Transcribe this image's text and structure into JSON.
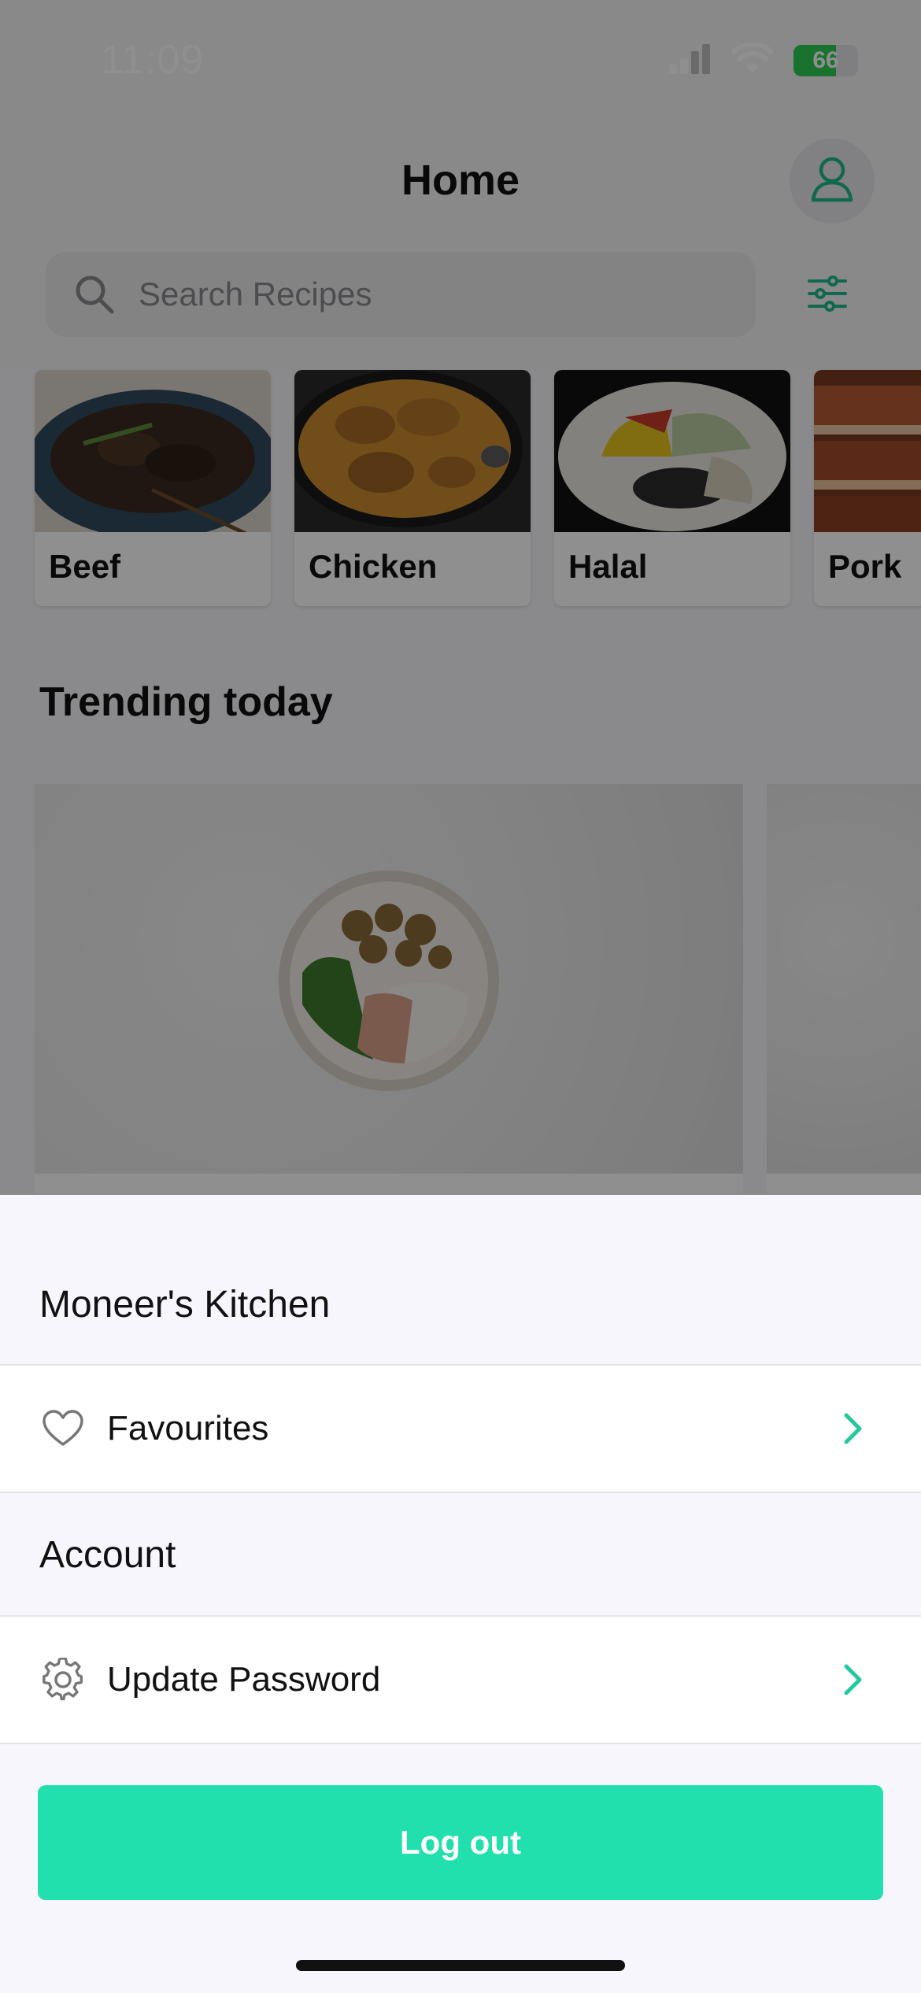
{
  "status_bar": {
    "time": "11:09",
    "battery": "66"
  },
  "header": {
    "title": "Home"
  },
  "search": {
    "placeholder": "Search Recipes"
  },
  "categories": [
    {
      "label": "Beef"
    },
    {
      "label": "Chicken"
    },
    {
      "label": "Halal"
    },
    {
      "label": "Pork"
    }
  ],
  "trending": {
    "title": "Trending today"
  },
  "sheet": {
    "kitchen_title": "Moneer's Kitchen",
    "favourites_label": "Favourites",
    "account_title": "Account",
    "update_password_label": "Update Password",
    "logout_label": "Log out"
  },
  "colors": {
    "accent": "#22dfae",
    "icon_teal": "#1fb98c"
  }
}
